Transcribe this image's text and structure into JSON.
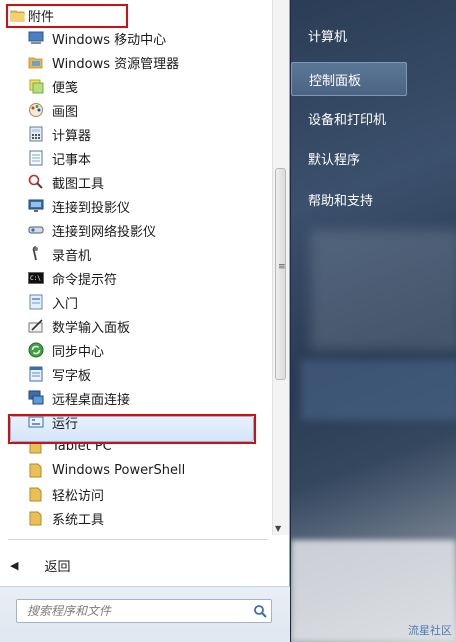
{
  "menu": {
    "header_label": "附件",
    "items": [
      {
        "label": "Windows 移动中心",
        "icon": "mobility-center-icon"
      },
      {
        "label": "Windows 资源管理器",
        "icon": "explorer-folder-icon"
      },
      {
        "label": "便笺",
        "icon": "sticky-notes-icon"
      },
      {
        "label": "画图",
        "icon": "paint-icon"
      },
      {
        "label": "计算器",
        "icon": "calculator-icon"
      },
      {
        "label": "记事本",
        "icon": "notepad-icon"
      },
      {
        "label": "截图工具",
        "icon": "snipping-tool-icon"
      },
      {
        "label": "连接到投影仪",
        "icon": "projector-icon"
      },
      {
        "label": "连接到网络投影仪",
        "icon": "network-projector-icon"
      },
      {
        "label": "录音机",
        "icon": "microphone-icon"
      },
      {
        "label": "命令提示符",
        "icon": "command-prompt-icon"
      },
      {
        "label": "入门",
        "icon": "getting-started-icon"
      },
      {
        "label": "数学输入面板",
        "icon": "math-input-icon"
      },
      {
        "label": "同步中心",
        "icon": "sync-center-icon"
      },
      {
        "label": "写字板",
        "icon": "wordpad-icon"
      },
      {
        "label": "远程桌面连接",
        "icon": "remote-desktop-icon"
      },
      {
        "label": "运行",
        "icon": "run-icon"
      },
      {
        "label": "Tablet PC",
        "icon": "folder-icon"
      },
      {
        "label": "Windows PowerShell",
        "icon": "folder-icon"
      },
      {
        "label": "轻松访问",
        "icon": "folder-icon"
      },
      {
        "label": "系统工具",
        "icon": "folder-icon"
      }
    ]
  },
  "back_label": "返回",
  "search": {
    "placeholder": "搜索程序和文件"
  },
  "right_panel": {
    "items": [
      {
        "label": "计算机"
      },
      {
        "label": "控制面板"
      },
      {
        "label": "设备和打印机"
      },
      {
        "label": "默认程序"
      },
      {
        "label": "帮助和支持"
      }
    ]
  },
  "watermark": "流星社区",
  "colors": {
    "highlight_box": "#d01010",
    "selection": "#d4e5f8",
    "right_panel_bg": "#2b3d56"
  }
}
